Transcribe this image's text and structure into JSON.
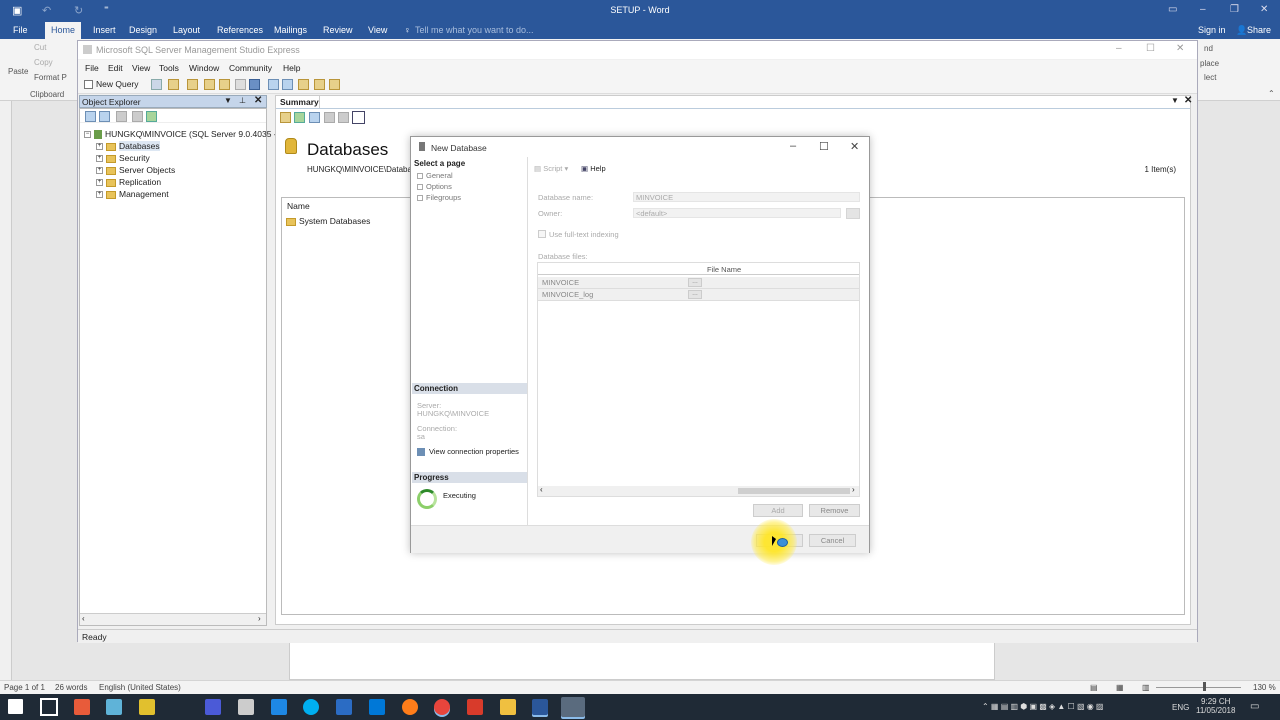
{
  "word": {
    "title": "SETUP - Word",
    "tabs": [
      "File",
      "Home",
      "Insert",
      "Design",
      "Layout",
      "References",
      "Mailings",
      "Review",
      "View"
    ],
    "tell_me": "Tell me what you want to do...",
    "sign_in": "Sign in",
    "share": "Share",
    "ribbon": {
      "paste": "Paste",
      "cut": "Cut",
      "copy": "Copy",
      "format": "Format P",
      "clipboard": "Clipboard",
      "find": "nd",
      "replace": "place",
      "select": "lect"
    },
    "status": {
      "page": "Page 1 of 1",
      "words": "26 words",
      "language": "English (United States)",
      "zoom": "130 %"
    }
  },
  "ssms": {
    "title": "Microsoft SQL Server Management Studio Express",
    "menu": [
      "File",
      "Edit",
      "View",
      "Tools",
      "Window",
      "Community",
      "Help"
    ],
    "new_query": "New Query",
    "object_explorer": {
      "title": "Object Explorer",
      "root": "HUNGKQ\\MINVOICE (SQL Server 9.0.4035 - s",
      "children": [
        "Databases",
        "Security",
        "Server Objects",
        "Replication",
        "Management"
      ]
    },
    "summary": {
      "tab": "Summary",
      "heading": "Databases",
      "path": "HUNGKQ\\MINVOICE\\Databas",
      "count": "1 Item(s)",
      "column_name": "Name",
      "rows": [
        "System Databases"
      ]
    },
    "status": "Ready"
  },
  "dialog": {
    "title": "New Database",
    "select_page": "Select a page",
    "pages": [
      "General",
      "Options",
      "Filegroups"
    ],
    "script_btn": "Script",
    "help_btn": "Help",
    "db_name_label": "Database name:",
    "db_name_value": "MINVOICE",
    "owner_label": "Owner:",
    "owner_value": "<default>",
    "fulltext_label": "Use full-text indexing",
    "db_files_label": "Database files:",
    "file_col": "File Name",
    "files": [
      "MINVOICE",
      "MINVOICE_log"
    ],
    "connection_heading": "Connection",
    "server_label": "Server:",
    "server_value": "HUNGKQ\\MINVOICE",
    "connection_label": "Connection:",
    "connection_value": "sa",
    "view_props": "View connection properties",
    "progress_heading": "Progress",
    "progress_status": "Executing",
    "add_btn": "Add",
    "remove_btn": "Remove",
    "ok_btn": "OK",
    "cancel_btn": "Cancel"
  },
  "taskbar": {
    "lang": "ENG",
    "time": "9:29 CH",
    "date": "11/05/2018"
  }
}
